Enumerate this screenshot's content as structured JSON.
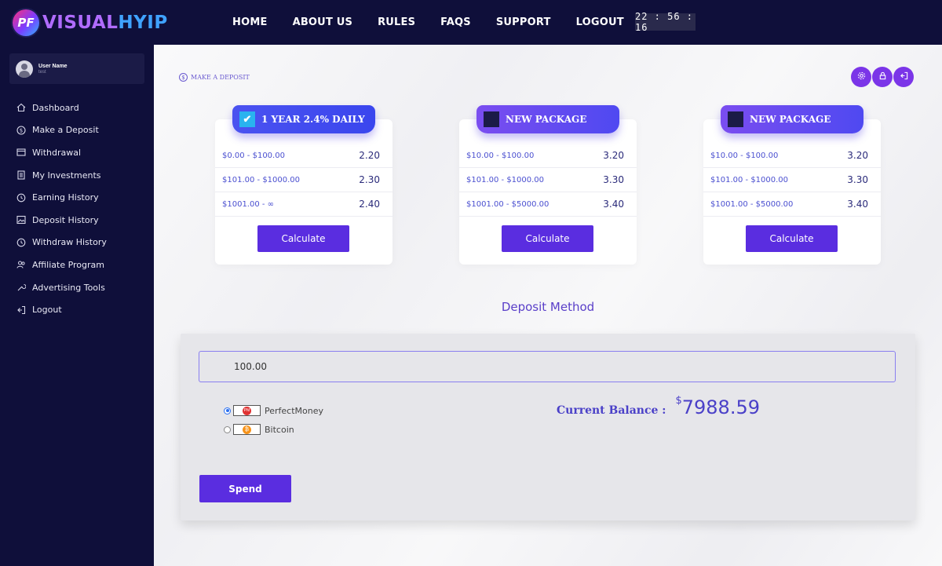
{
  "brand": {
    "logo_mark": "PF",
    "name_part1": "VISUAL",
    "name_part2": "HYIP"
  },
  "nav": [
    "HOME",
    "ABOUT US",
    "RULES",
    "FAQS",
    "SUPPORT",
    "LOGOUT"
  ],
  "clock": "22 : 56 : 16",
  "user": {
    "name": "User Name",
    "sub": "test"
  },
  "sidebar": {
    "items": [
      {
        "label": "Dashboard",
        "icon": "home-icon"
      },
      {
        "label": "Make a Deposit",
        "icon": "dollar-circle-icon"
      },
      {
        "label": "Withdrawal",
        "icon": "wallet-icon"
      },
      {
        "label": "My Investments",
        "icon": "document-icon"
      },
      {
        "label": "Earning History",
        "icon": "history-icon"
      },
      {
        "label": "Deposit History",
        "icon": "image-icon"
      },
      {
        "label": "Withdraw History",
        "icon": "history-icon"
      },
      {
        "label": "Affiliate Program",
        "icon": "users-icon"
      },
      {
        "label": "Advertising Tools",
        "icon": "tools-icon"
      },
      {
        "label": "Logout",
        "icon": "logout-icon"
      }
    ]
  },
  "breadcrumb": {
    "label": "MAKE A DEPOSIT"
  },
  "packages": [
    {
      "name": "1 YEAR 2.4% DAILY",
      "selected": true,
      "rows": [
        {
          "range": "$0.00 - $100.00",
          "rate": "2.20"
        },
        {
          "range": "$101.00 - $1000.00",
          "rate": "2.30"
        },
        {
          "range": "$1001.00 - ∞",
          "rate": "2.40"
        }
      ],
      "button": "Calculate"
    },
    {
      "name": "NEW PACKAGE",
      "selected": false,
      "rows": [
        {
          "range": "$10.00 - $100.00",
          "rate": "3.20"
        },
        {
          "range": "$101.00 - $1000.00",
          "rate": "3.30"
        },
        {
          "range": "$1001.00 - $5000.00",
          "rate": "3.40"
        }
      ],
      "button": "Calculate"
    },
    {
      "name": "NEW PACKAGE",
      "selected": false,
      "rows": [
        {
          "range": "$10.00 - $100.00",
          "rate": "3.20"
        },
        {
          "range": "$101.00 - $1000.00",
          "rate": "3.30"
        },
        {
          "range": "$1001.00 - $5000.00",
          "rate": "3.40"
        }
      ],
      "button": "Calculate"
    }
  ],
  "deposit": {
    "title": "Deposit Method",
    "amount": "100.00",
    "methods": [
      {
        "label": "PerfectMoney",
        "logo_text": "PM",
        "selected": true
      },
      {
        "label": "Bitcoin",
        "logo_text": "₿",
        "selected": false
      }
    ],
    "balance_label": "Current Balance :",
    "balance_currency": "$",
    "balance_value": "7988.59",
    "spend_label": "Spend"
  },
  "colors": {
    "accent": "#5a2de0",
    "sidebar": "#0f0f3a",
    "text_accent": "#4a40c8"
  }
}
